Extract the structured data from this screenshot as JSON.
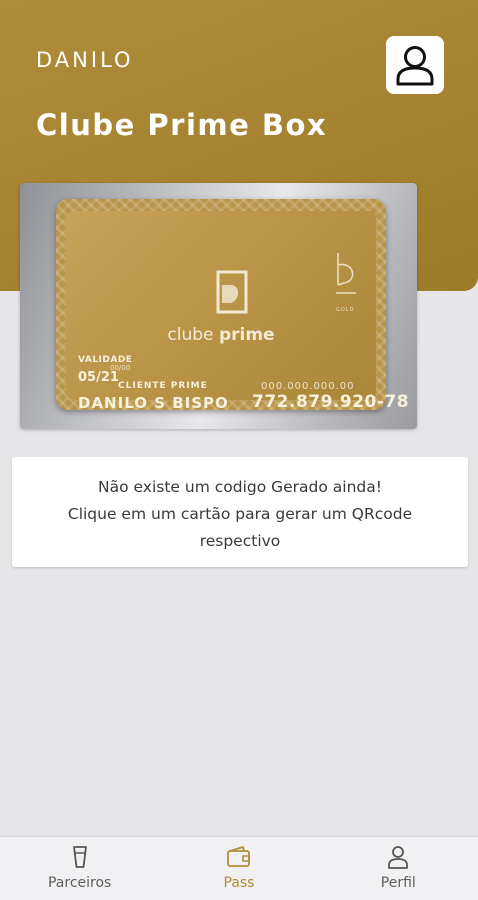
{
  "header": {
    "user_name": "DANILO",
    "app_title": "Clube Prime Box",
    "background_color": "#a88532",
    "profile_icon": "user-outline-icon"
  },
  "card": {
    "brand_regular": "clube",
    "brand_bold": "prime",
    "tier": "GOLD",
    "validity_label": "VALIDADE",
    "validity_format": "00/00",
    "validity": "05/21",
    "client_label": "CLIENTE PRIME",
    "holder_name": "DANILO S BISPO",
    "number_mask": "000.000.000.00",
    "number": "772.879.920-78",
    "color": "#b99447"
  },
  "message": {
    "line1": "Não existe um codigo Gerado ainda!",
    "line2": "Clique em um cartão para gerar um QRcode",
    "line3": "respectivo"
  },
  "tabs": [
    {
      "label": "Parceiros",
      "icon": "glass-icon",
      "active": false
    },
    {
      "label": "Pass",
      "icon": "wallet-icon",
      "active": true
    },
    {
      "label": "Perfil",
      "icon": "person-icon",
      "active": false
    }
  ],
  "colors": {
    "accent": "#b08d3a",
    "inactive_tab": "#5d5d5d",
    "page_background": "#e6e5e8"
  }
}
